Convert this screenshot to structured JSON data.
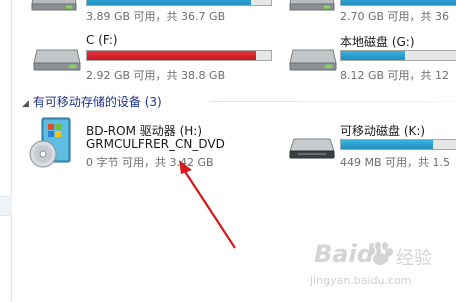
{
  "drives": {
    "top_left": {
      "sub": "3.89 GB 可用，共 36.7 GB",
      "used_fraction": 0.89
    },
    "top_right": {
      "sub": "2.70 GB 可用，共 36",
      "used_fraction": 0.92
    },
    "c_drive": {
      "name": "C (F:)",
      "sub": "2.92 GB 可用，共 38.8 GB",
      "used_fraction": 0.92,
      "bar_color": "#d21e27"
    },
    "local_g": {
      "name": "本地磁盘 (G:)",
      "sub": "8.12 GB 可用，共 12",
      "used_fraction": 0.5,
      "bar_color": "#1e8fc2"
    }
  },
  "removable_section": {
    "title": "有可移动存储的设备 (3)"
  },
  "removable": {
    "bdrom": {
      "name": "BD-ROM 驱动器 (H:)",
      "label": "GRMCULFRER_CN_DVD",
      "sub": "0 字节 可用，共 3.42 GB"
    },
    "removable_k": {
      "name": "可移动磁盘 (K:)",
      "sub": "449 MB 可用，共 1.5",
      "used_fraction": 0.72
    }
  },
  "watermark": {
    "brand": "Baidu",
    "jingyan": "经验",
    "url": "jingyan.baidu.com"
  },
  "colors": {
    "section_header": "#1e3287",
    "bar_blue": "#1e8fc2",
    "bar_red": "#d21e27",
    "arrow": "#d41a1a"
  }
}
